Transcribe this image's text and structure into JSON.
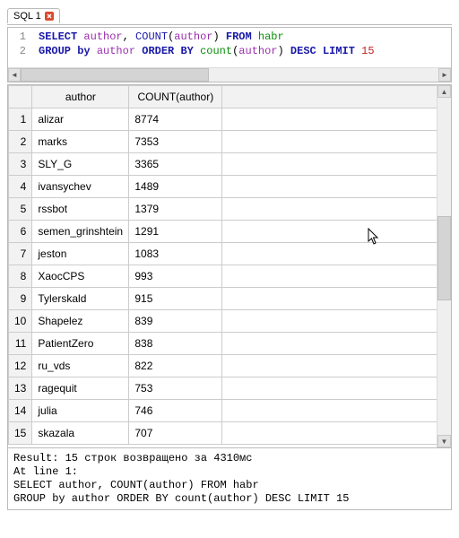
{
  "tab": {
    "label": "SQL 1"
  },
  "editor": {
    "line_numbers": [
      "1",
      "2"
    ],
    "tokens": [
      [
        {
          "t": "SELECT",
          "c": "kw"
        },
        {
          "t": " "
        },
        {
          "t": "author",
          "c": "id1"
        },
        {
          "t": ", "
        },
        {
          "t": "COUNT",
          "c": "fn"
        },
        {
          "t": "("
        },
        {
          "t": "author",
          "c": "id1"
        },
        {
          "t": ")"
        },
        {
          "t": " "
        },
        {
          "t": "FROM",
          "c": "kw"
        },
        {
          "t": " "
        },
        {
          "t": "habr",
          "c": "id2"
        }
      ],
      [
        {
          "t": "GROUP",
          "c": "kw"
        },
        {
          "t": " "
        },
        {
          "t": "by",
          "c": "kw"
        },
        {
          "t": " "
        },
        {
          "t": "author",
          "c": "id1"
        },
        {
          "t": " "
        },
        {
          "t": "ORDER",
          "c": "kw"
        },
        {
          "t": " "
        },
        {
          "t": "BY",
          "c": "kw"
        },
        {
          "t": " "
        },
        {
          "t": "count",
          "c": "id2"
        },
        {
          "t": "("
        },
        {
          "t": "author",
          "c": "id1"
        },
        {
          "t": ")"
        },
        {
          "t": " "
        },
        {
          "t": "DESC",
          "c": "kw"
        },
        {
          "t": " "
        },
        {
          "t": "LIMIT",
          "c": "kw"
        },
        {
          "t": " "
        },
        {
          "t": "15",
          "c": "num"
        }
      ]
    ]
  },
  "results": {
    "columns": [
      "author",
      "COUNT(author)"
    ],
    "rows": [
      {
        "n": "1",
        "author": "alizar",
        "count": "8774"
      },
      {
        "n": "2",
        "author": "marks",
        "count": "7353"
      },
      {
        "n": "3",
        "author": "SLY_G",
        "count": "3365"
      },
      {
        "n": "4",
        "author": "ivansychev",
        "count": "1489"
      },
      {
        "n": "5",
        "author": "rssbot",
        "count": "1379"
      },
      {
        "n": "6",
        "author": "semen_grinshtein",
        "count": "1291"
      },
      {
        "n": "7",
        "author": "jeston",
        "count": "1083"
      },
      {
        "n": "8",
        "author": "XaocCPS",
        "count": "993"
      },
      {
        "n": "9",
        "author": "Tylerskald",
        "count": "915"
      },
      {
        "n": "10",
        "author": "Shapelez",
        "count": "839"
      },
      {
        "n": "11",
        "author": "PatientZero",
        "count": "838"
      },
      {
        "n": "12",
        "author": "ru_vds",
        "count": "822"
      },
      {
        "n": "13",
        "author": "ragequit",
        "count": "753"
      },
      {
        "n": "14",
        "author": "julia",
        "count": "746"
      },
      {
        "n": "15",
        "author": "skazala",
        "count": "707"
      }
    ]
  },
  "status": {
    "line1": "Result: 15 строк возвращено за 4310мс",
    "line2": "At line 1:",
    "line3": "SELECT author, COUNT(author) FROM habr",
    "line4": "GROUP by author ORDER BY count(author) DESC LIMIT 15"
  },
  "glyphs": {
    "left": "◄",
    "right": "►",
    "up": "▲",
    "down": "▼"
  }
}
